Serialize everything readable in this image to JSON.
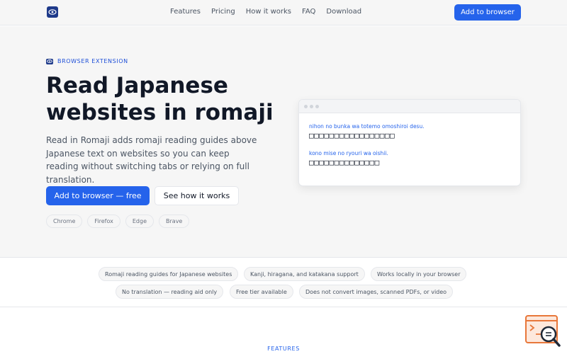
{
  "header": {
    "nav": [
      "Features",
      "Pricing",
      "How it works",
      "FAQ",
      "Download"
    ],
    "cta": "Add to browser"
  },
  "hero": {
    "eyebrow": "BROWSER EXTENSION",
    "title": "Read Japanese websites in romaji",
    "subtitle": "Read in Romaji adds romaji reading guides above Japanese text on websites so you can keep reading without switching tabs or relying on full translation.",
    "primary_button": "Add to browser — free",
    "secondary_button": "See how it works",
    "browsers": [
      "Chrome",
      "Firefox",
      "Edge",
      "Brave"
    ]
  },
  "demo": {
    "lines": [
      {
        "romaji": "nihon no bunka wa totemo omoshiroi desu.",
        "japanese": "□□□□□□□□□□□□□□□□□"
      },
      {
        "romaji": "kono mise no ryouri wa oishii.",
        "japanese": "□□□□□□□□□□□□□□"
      }
    ]
  },
  "feature_pills": [
    "Romaji reading guides for Japanese websites",
    "Kanji, hiragana, and katakana support",
    "Works locally in your browser",
    "No translation — reading aid only",
    "Free tier available",
    "Does not convert images, scanned PDFs, or video"
  ],
  "features_section": {
    "label": "FEATURES"
  },
  "colors": {
    "accent": "#2563eb",
    "navy": "#1e3a8a",
    "badge_orange": "#e8773a"
  },
  "icons": {
    "logo": "eye-icon",
    "badge": "search-document-icon"
  }
}
